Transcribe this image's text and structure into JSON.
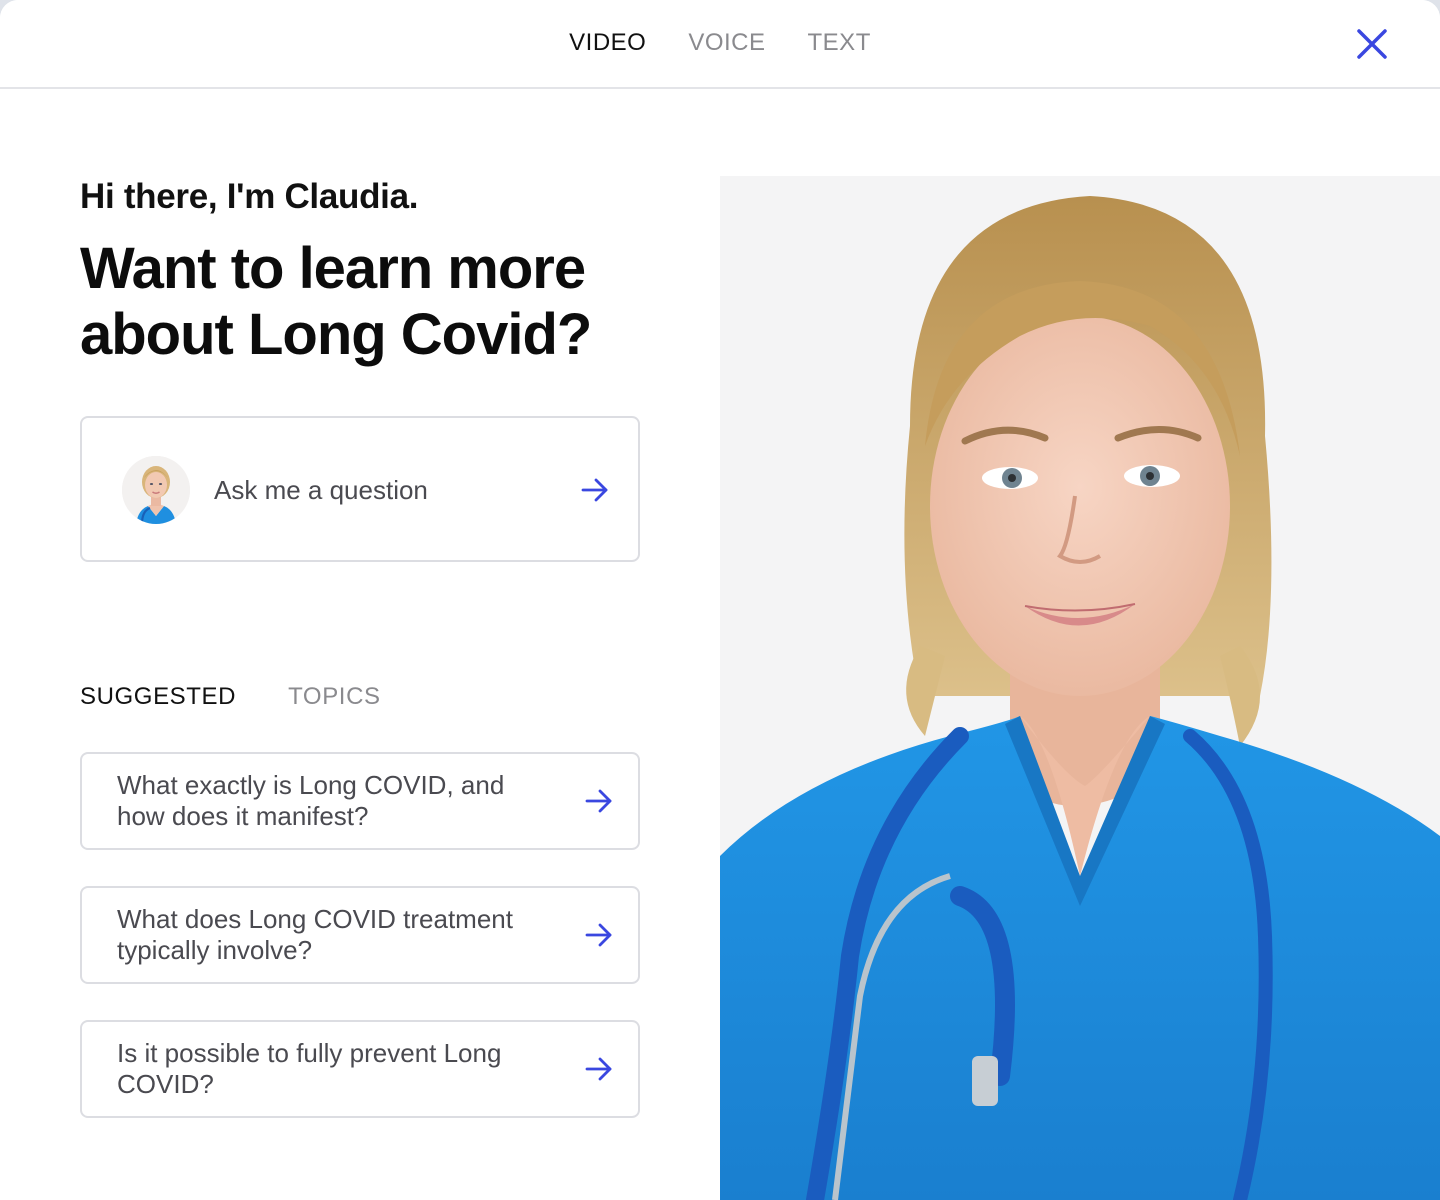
{
  "header": {
    "tabs": [
      {
        "label": "VIDEO",
        "active": true
      },
      {
        "label": "VOICE",
        "active": false
      },
      {
        "label": "TEXT",
        "active": false
      }
    ],
    "close_icon": "close-icon"
  },
  "intro": {
    "greeting": "Hi there, I'm Claudia.",
    "headline": "Want to learn more about Long Covid?"
  },
  "ask": {
    "label": "Ask me a question",
    "icon": "arrow-right-icon"
  },
  "topics": {
    "tabs": [
      {
        "label": "SUGGESTED",
        "active": true
      },
      {
        "label": "TOPICS",
        "active": false
      }
    ]
  },
  "suggestions": [
    {
      "text": "What exactly is Long COVID, and how does it manifest?"
    },
    {
      "text": "What does Long COVID treatment typically involve?"
    },
    {
      "text": "Is it possible to fully prevent Long COVID?"
    }
  ],
  "colors": {
    "accent": "#3a47e0",
    "scrubs": "#1f8fe0",
    "text_muted": "#8a8a8e"
  }
}
